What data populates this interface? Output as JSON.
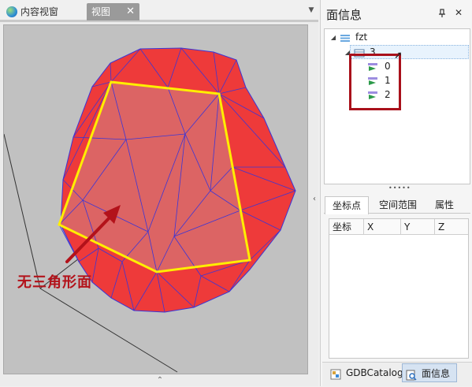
{
  "tabs": {
    "content_view": "内容视窗",
    "view": "视图",
    "close_glyph": "✕",
    "dropdown_glyph": "▼"
  },
  "viewport": {
    "annotation": "无三角形面",
    "colors": {
      "background": "#c1c1c1",
      "fill": "#ee3a3a",
      "edges": "#3b35d6",
      "highlight_polygon": "#ffee00",
      "annotation": "#b3121a"
    }
  },
  "panel": {
    "title": "面信息",
    "pin_glyph": "📌",
    "close_glyph": "✕",
    "tree": {
      "root": "fzt",
      "layer": "3",
      "faces": [
        "0",
        "1",
        "2"
      ]
    },
    "splitter": "•••••",
    "sub_tabs": [
      "坐标点",
      "空间范围",
      "属性"
    ],
    "table_columns": [
      "坐标",
      "X",
      "Y",
      "Z"
    ],
    "bottom_tabs": [
      "GDBCatalog",
      "面信息"
    ]
  },
  "glyphs": {
    "collapse_bottom": "⌃",
    "collapse_side": "‹",
    "tree_expanded": "◢",
    "cursor": "➚"
  }
}
